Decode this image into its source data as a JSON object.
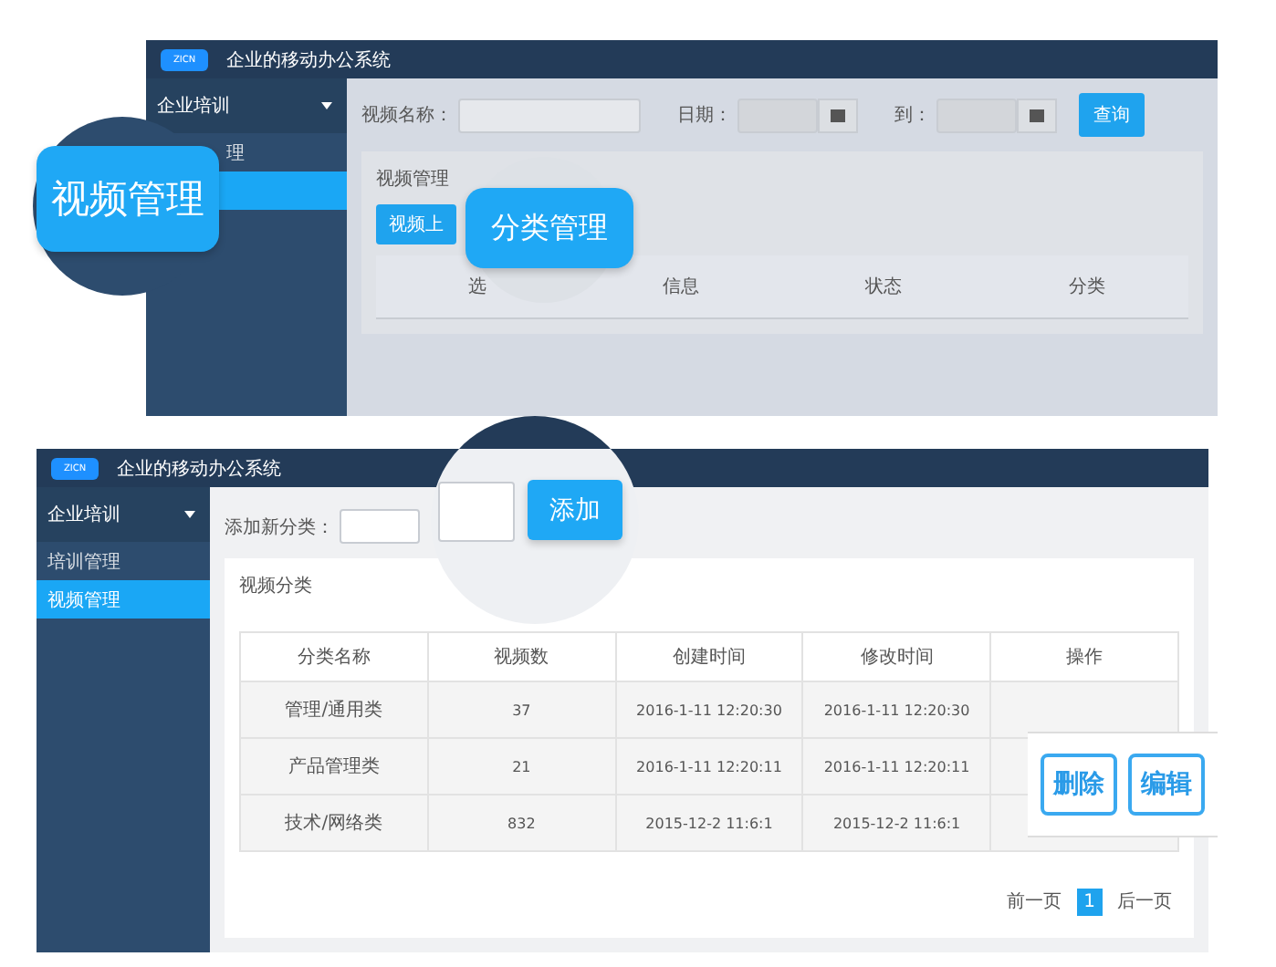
{
  "top_screen": {
    "logo": "ZICN",
    "title": "企业的移动办公系统",
    "sidebar": {
      "group": "企业培训",
      "items": [
        {
          "label": "理",
          "selected": false
        },
        {
          "selected": true
        }
      ]
    },
    "filters": [
      {
        "label": "视频名称：",
        "kind": "text"
      },
      {
        "label": "日期：",
        "kind": "date"
      },
      {
        "label": "到：",
        "kind": "date"
      }
    ],
    "search_button": "查询",
    "panel_title": "视频管理",
    "upload_button": "视频上",
    "columns": [
      "选",
      "信息",
      "状态",
      "分类"
    ]
  },
  "bottom_screen": {
    "logo": "ZICN",
    "title": "企业的移动办公系统",
    "sidebar": {
      "group": "企业培训",
      "items": [
        {
          "label": "培训管理",
          "selected": false
        },
        {
          "label": "视频管理",
          "selected": true
        }
      ]
    },
    "add_label": "添加新分类：",
    "panel_title": "视频分类",
    "columns": [
      "分类名称",
      "视频数",
      "创建时间",
      "修改时间",
      "操作"
    ],
    "rows": [
      [
        "管理/通用类",
        "37",
        "2016-1-11 12:20:30",
        "2016-1-11 12:20:30"
      ],
      [
        "产品管理类",
        "21",
        "2016-1-11 12:20:11",
        "2016-1-11 12:20:11"
      ],
      [
        "技术/网络类",
        "832",
        "2015-12-2 11:6:1",
        "2015-12-2 11:6:1"
      ]
    ],
    "pagination": [
      {
        "label": "前一页",
        "selected": false
      },
      {
        "label": "1",
        "selected": true
      },
      {
        "label": "后一页",
        "selected": false
      }
    ]
  },
  "callouts": [
    {
      "kind": "menu",
      "label": "视频管理"
    },
    {
      "kind": "tab",
      "label": "分类管理"
    },
    {
      "kind": "add",
      "label": "添加"
    },
    {
      "kind": "actions",
      "buttons": [
        "删除",
        "编辑"
      ]
    }
  ]
}
